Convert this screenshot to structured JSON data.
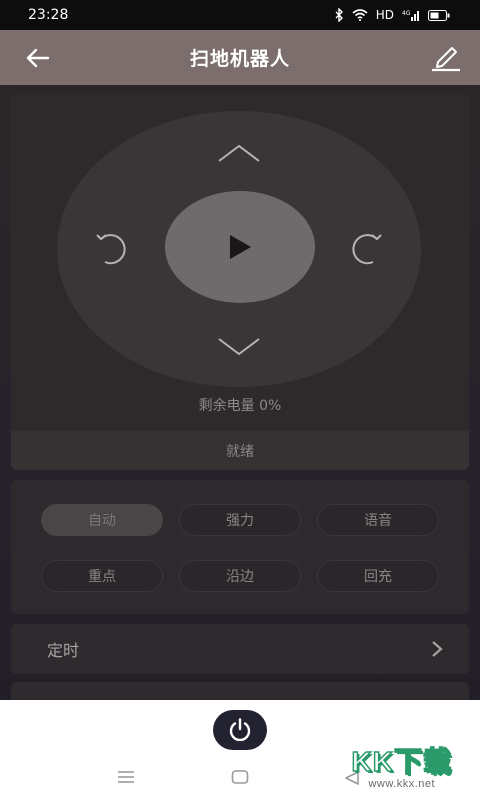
{
  "status_bar": {
    "time": "23:28",
    "network_label": "HD",
    "signal_label": "4G"
  },
  "header": {
    "title": "扫地机器人"
  },
  "control": {
    "battery_text": "剩余电量 0%",
    "status_text": "就绪"
  },
  "modes": [
    {
      "label": "自动",
      "active": true
    },
    {
      "label": "强力",
      "active": false
    },
    {
      "label": "语音",
      "active": false
    },
    {
      "label": "重点",
      "active": false
    },
    {
      "label": "沿边",
      "active": false
    },
    {
      "label": "回充",
      "active": false
    }
  ],
  "timer": {
    "label": "定时"
  },
  "watermark": {
    "brand": "KK下载",
    "site": "www.kkx.net"
  },
  "icons": {
    "back": "arrow-left-icon",
    "edit": "pencil-icon",
    "play": "play-icon",
    "power": "power-icon"
  },
  "colors": {
    "header": "#7c6e6c",
    "background": "#2a2627",
    "dpad": "#3a3537",
    "play": "#6f6a6b",
    "power_button": "#222231"
  }
}
